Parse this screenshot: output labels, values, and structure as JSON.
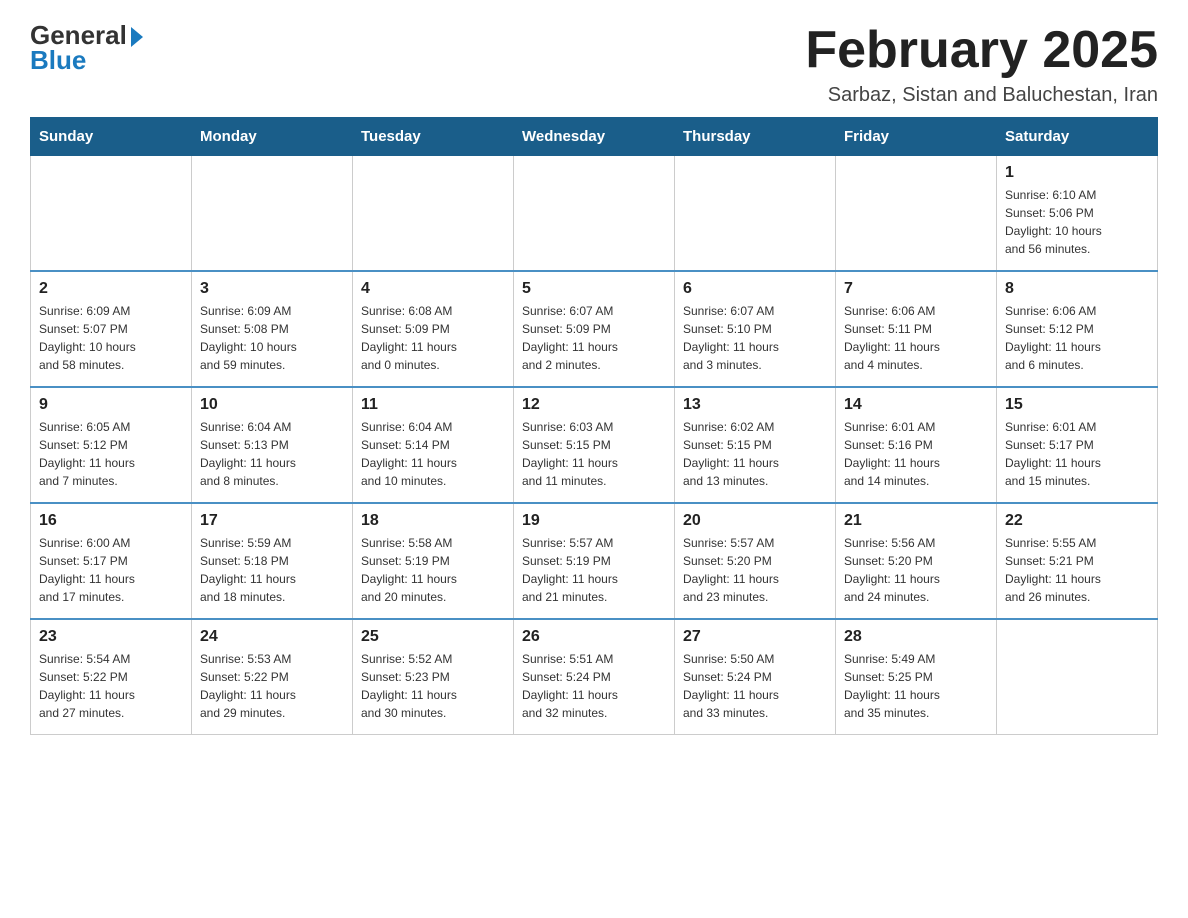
{
  "logo": {
    "general": "General",
    "blue": "Blue"
  },
  "title": "February 2025",
  "subtitle": "Sarbaz, Sistan and Baluchestan, Iran",
  "weekdays": [
    "Sunday",
    "Monday",
    "Tuesday",
    "Wednesday",
    "Thursday",
    "Friday",
    "Saturday"
  ],
  "weeks": [
    [
      {
        "day": "",
        "detail": ""
      },
      {
        "day": "",
        "detail": ""
      },
      {
        "day": "",
        "detail": ""
      },
      {
        "day": "",
        "detail": ""
      },
      {
        "day": "",
        "detail": ""
      },
      {
        "day": "",
        "detail": ""
      },
      {
        "day": "1",
        "detail": "Sunrise: 6:10 AM\nSunset: 5:06 PM\nDaylight: 10 hours\nand 56 minutes."
      }
    ],
    [
      {
        "day": "2",
        "detail": "Sunrise: 6:09 AM\nSunset: 5:07 PM\nDaylight: 10 hours\nand 58 minutes."
      },
      {
        "day": "3",
        "detail": "Sunrise: 6:09 AM\nSunset: 5:08 PM\nDaylight: 10 hours\nand 59 minutes."
      },
      {
        "day": "4",
        "detail": "Sunrise: 6:08 AM\nSunset: 5:09 PM\nDaylight: 11 hours\nand 0 minutes."
      },
      {
        "day": "5",
        "detail": "Sunrise: 6:07 AM\nSunset: 5:09 PM\nDaylight: 11 hours\nand 2 minutes."
      },
      {
        "day": "6",
        "detail": "Sunrise: 6:07 AM\nSunset: 5:10 PM\nDaylight: 11 hours\nand 3 minutes."
      },
      {
        "day": "7",
        "detail": "Sunrise: 6:06 AM\nSunset: 5:11 PM\nDaylight: 11 hours\nand 4 minutes."
      },
      {
        "day": "8",
        "detail": "Sunrise: 6:06 AM\nSunset: 5:12 PM\nDaylight: 11 hours\nand 6 minutes."
      }
    ],
    [
      {
        "day": "9",
        "detail": "Sunrise: 6:05 AM\nSunset: 5:12 PM\nDaylight: 11 hours\nand 7 minutes."
      },
      {
        "day": "10",
        "detail": "Sunrise: 6:04 AM\nSunset: 5:13 PM\nDaylight: 11 hours\nand 8 minutes."
      },
      {
        "day": "11",
        "detail": "Sunrise: 6:04 AM\nSunset: 5:14 PM\nDaylight: 11 hours\nand 10 minutes."
      },
      {
        "day": "12",
        "detail": "Sunrise: 6:03 AM\nSunset: 5:15 PM\nDaylight: 11 hours\nand 11 minutes."
      },
      {
        "day": "13",
        "detail": "Sunrise: 6:02 AM\nSunset: 5:15 PM\nDaylight: 11 hours\nand 13 minutes."
      },
      {
        "day": "14",
        "detail": "Sunrise: 6:01 AM\nSunset: 5:16 PM\nDaylight: 11 hours\nand 14 minutes."
      },
      {
        "day": "15",
        "detail": "Sunrise: 6:01 AM\nSunset: 5:17 PM\nDaylight: 11 hours\nand 15 minutes."
      }
    ],
    [
      {
        "day": "16",
        "detail": "Sunrise: 6:00 AM\nSunset: 5:17 PM\nDaylight: 11 hours\nand 17 minutes."
      },
      {
        "day": "17",
        "detail": "Sunrise: 5:59 AM\nSunset: 5:18 PM\nDaylight: 11 hours\nand 18 minutes."
      },
      {
        "day": "18",
        "detail": "Sunrise: 5:58 AM\nSunset: 5:19 PM\nDaylight: 11 hours\nand 20 minutes."
      },
      {
        "day": "19",
        "detail": "Sunrise: 5:57 AM\nSunset: 5:19 PM\nDaylight: 11 hours\nand 21 minutes."
      },
      {
        "day": "20",
        "detail": "Sunrise: 5:57 AM\nSunset: 5:20 PM\nDaylight: 11 hours\nand 23 minutes."
      },
      {
        "day": "21",
        "detail": "Sunrise: 5:56 AM\nSunset: 5:20 PM\nDaylight: 11 hours\nand 24 minutes."
      },
      {
        "day": "22",
        "detail": "Sunrise: 5:55 AM\nSunset: 5:21 PM\nDaylight: 11 hours\nand 26 minutes."
      }
    ],
    [
      {
        "day": "23",
        "detail": "Sunrise: 5:54 AM\nSunset: 5:22 PM\nDaylight: 11 hours\nand 27 minutes."
      },
      {
        "day": "24",
        "detail": "Sunrise: 5:53 AM\nSunset: 5:22 PM\nDaylight: 11 hours\nand 29 minutes."
      },
      {
        "day": "25",
        "detail": "Sunrise: 5:52 AM\nSunset: 5:23 PM\nDaylight: 11 hours\nand 30 minutes."
      },
      {
        "day": "26",
        "detail": "Sunrise: 5:51 AM\nSunset: 5:24 PM\nDaylight: 11 hours\nand 32 minutes."
      },
      {
        "day": "27",
        "detail": "Sunrise: 5:50 AM\nSunset: 5:24 PM\nDaylight: 11 hours\nand 33 minutes."
      },
      {
        "day": "28",
        "detail": "Sunrise: 5:49 AM\nSunset: 5:25 PM\nDaylight: 11 hours\nand 35 minutes."
      },
      {
        "day": "",
        "detail": ""
      }
    ]
  ]
}
